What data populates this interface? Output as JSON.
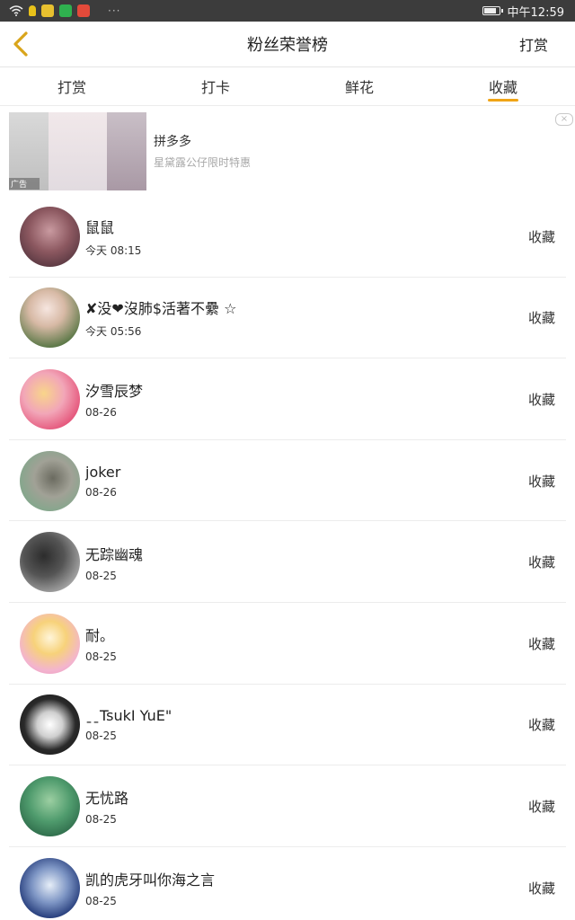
{
  "status_bar": {
    "time": "中午12:59",
    "dots": "···",
    "battery_level": 0.85
  },
  "header": {
    "title": "粉丝荣誉榜",
    "action": "打赏"
  },
  "tabs": [
    {
      "label": "打赏"
    },
    {
      "label": "打卡"
    },
    {
      "label": "鲜花"
    },
    {
      "label": "收藏"
    }
  ],
  "active_tab": "收藏",
  "ad": {
    "title": "拼多多",
    "subtitle": "星黛露公仔限时特惠",
    "badge": "广告",
    "close": "×"
  },
  "list": [
    {
      "name": "鼠鼠",
      "time": "今天 08:15",
      "action": "收藏"
    },
    {
      "name": "✘没❤沒肺$活著不纍 ☆",
      "time": "今天 05:56",
      "action": "收藏"
    },
    {
      "name": "汐雪辰梦",
      "time": "08-26",
      "action": "收藏"
    },
    {
      "name": "joker",
      "time": "08-26",
      "action": "收藏"
    },
    {
      "name": "无踪幽魂",
      "time": "08-25",
      "action": "收藏"
    },
    {
      "name": "耐。",
      "time": "08-25",
      "action": "收藏"
    },
    {
      "name": "ˍˍTsukI YuE\"",
      "time": "08-25",
      "action": "收藏"
    },
    {
      "name": "无忧路",
      "time": "08-25",
      "action": "收藏"
    },
    {
      "name": "凯的虎牙叫你海之言",
      "time": "08-25",
      "action": "收藏"
    }
  ],
  "colors": {
    "accent": "#f0a416",
    "status_bar": "#3c3c3c"
  }
}
